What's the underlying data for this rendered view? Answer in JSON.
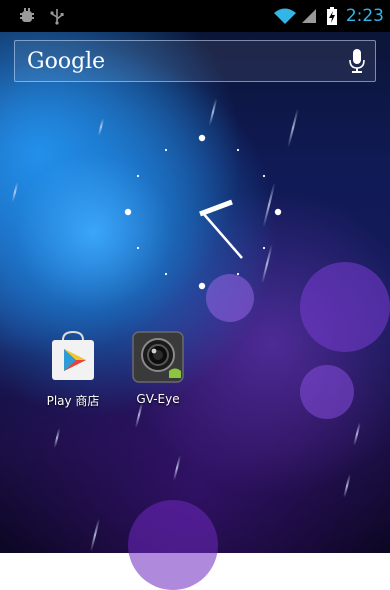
{
  "status_bar": {
    "time": "2:23",
    "time_color": "#33b5e5",
    "left_icons": [
      "debug-bug-icon",
      "usb-icon"
    ],
    "right_icons": [
      "wifi-icon",
      "cell-signal-icon",
      "battery-charging-icon"
    ]
  },
  "search": {
    "label": "Google",
    "mic_icon": "microphone-icon"
  },
  "apps": [
    {
      "label": "Play 商店",
      "icon": "play-store-icon"
    },
    {
      "label": "GV-Eye",
      "icon": "camera-icon"
    }
  ],
  "colors": {
    "accent": "#33b5e5",
    "clock_hands": "#ffffff"
  }
}
